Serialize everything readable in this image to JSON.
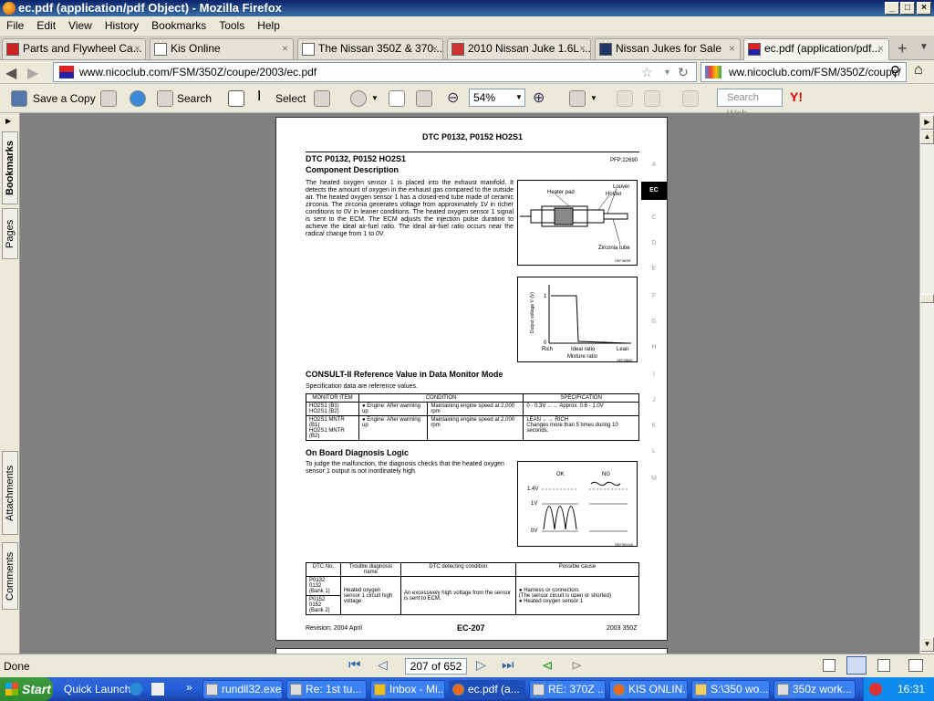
{
  "window": {
    "title": "ec.pdf (application/pdf Object) - Mozilla Firefox"
  },
  "menu": [
    "File",
    "Edit",
    "View",
    "History",
    "Bookmarks",
    "Tools",
    "Help"
  ],
  "tabs": [
    {
      "label": "Parts and Flywheel Ca..."
    },
    {
      "label": "Kis Online"
    },
    {
      "label": "The Nissan 350Z & 370..."
    },
    {
      "label": "2010 Nissan Juke 1.6L ..."
    },
    {
      "label": "Nissan Jukes for Sale"
    },
    {
      "label": "ec.pdf (application/pdf..."
    }
  ],
  "nav": {
    "url": "www.nicoclub.com/FSM/350Z/coupe/2003/ec.pdf",
    "search_text": "ww.nicoclub.com/FSM/350Z/coupe/"
  },
  "pdf_toolbar": {
    "save_label": "Save a Copy",
    "search_label": "Search",
    "select_label": "Select",
    "zoom": "54%",
    "search_web_placeholder": "Search Web"
  },
  "side_tabs": [
    "Bookmarks",
    "Pages",
    "Attachments",
    "Comments"
  ],
  "pdf": {
    "page_title": "DTC P0132, P0152 HO2S1",
    "section_header": "DTC P0132, P0152 HO2S1",
    "pfp_code": "PFP:22690",
    "component_desc_heading": "Component Description",
    "component_desc_text": "The heated oxygen sensor 1 is placed into the exhaust manifold. It detects the amount of oxygen in the exhaust gas compared to the outside air. The heated oxygen sensor 1 has a closed-end tube made of ceramic zirconia. The zirconia generates voltage from approximately 1V in richer conditions to 0V in leaner conditions. The heated oxygen sensor 1 signal is sent to the ECM. The ECM adjusts the injection pulse duration to achieve the ideal air-fuel ratio. The ideal air-fuel ratio occurs near the radical change from 1 to 0V.",
    "sensor_labels": {
      "heater": "Heater pad",
      "louver": "Louver",
      "holder": "Holder",
      "tube": "Zirconia tube",
      "ref": "SEF463R"
    },
    "graph1": {
      "ylabel": "Output voltage V (V)",
      "y1": "1",
      "y0": "0",
      "rich": "Rich",
      "ideal": "Ideal ratio",
      "lean": "Lean",
      "xlabel": "Mixture ratio",
      "ref": "SEF288D"
    },
    "consult_heading": "CONSULT-II Reference Value in Data Monitor Mode",
    "spec_note": "Specification data are reference values.",
    "consult_table": {
      "headers": [
        "MONITOR ITEM",
        "CONDITION",
        "SPECIFICATION"
      ],
      "rows": [
        {
          "item": "HO2S1 (B1)\nHO2S1 (B2)",
          "cond1": "● Engine: After warming up",
          "cond2": "Maintaining engine speed at 2,000 rpm",
          "spec": "0 - 0.3V ←→ Approx. 0.6 - 1.0V"
        },
        {
          "item": "HO2S1 MNTR (B1)\nHO2S1 MNTR (B2)",
          "cond1": "● Engine: After warming up",
          "cond2": "Maintaining engine speed at 2,000 rpm",
          "spec": "LEAN ←→ RICH\nChanges more than 5 times during 10 seconds."
        }
      ]
    },
    "obd_heading": "On Board Diagnosis Logic",
    "obd_text": "To judge the malfunction, the diagnosis checks that the heated oxygen sensor 1 output is not inordinately high.",
    "graph2": {
      "ok": "OK",
      "ng": "NG",
      "v14": "1.4V",
      "v1": "1V",
      "v0": "0V",
      "ref": "SEF301UA"
    },
    "dtc_table": {
      "headers": [
        "DTC No.",
        "Trouble diagnosis name",
        "DTC detecting condition",
        "Possible cause"
      ],
      "dtc1": "P0132\n0132\n(Bank 1)",
      "dtc2": "P0152\n0152\n(Bank 2)",
      "name": "Heated oxygen sensor 1 circuit high voltage",
      "condition": "An excessively high voltage from the sensor is sent to ECM.",
      "cause1": "● Harness or connectors\n(The sensor circuit is open or shorted)",
      "cause2": "● Heated oxygen sensor 1"
    },
    "footer_left": "Revision; 2004 April",
    "footer_center": "EC-207",
    "footer_right": "2003 350Z",
    "side_letters": [
      "A",
      "EC",
      "C",
      "D",
      "E",
      "F",
      "G",
      "H",
      "I",
      "J",
      "K",
      "L",
      "M"
    ]
  },
  "status": {
    "text": "Done",
    "page": "207 of 652"
  },
  "taskbar": {
    "start": "Start",
    "quick_launch": "Quick Launch",
    "tasks": [
      "rundll32.exe -...",
      "Re: 1st tu...",
      "Inbox - Mi...",
      "ec.pdf (a...",
      "RE: 370Z ...",
      "KIS ONLIN...",
      "S:\\350 wo...",
      "350z work..."
    ],
    "clock": "16:31"
  }
}
